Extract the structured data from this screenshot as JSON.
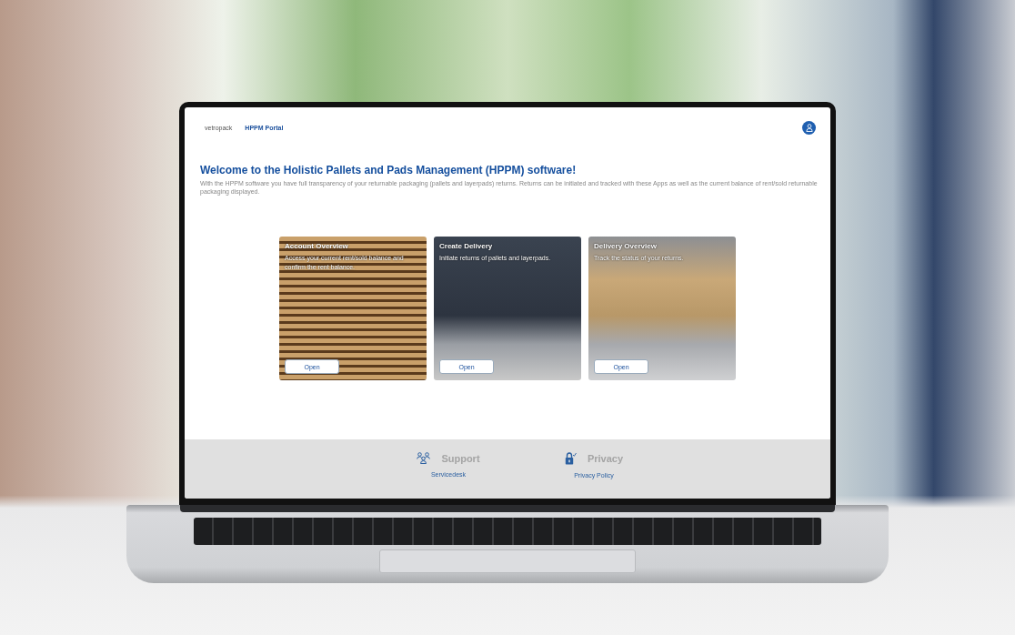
{
  "header": {
    "logo": "vetropack",
    "portal_title": "HPPM Portal"
  },
  "welcome": {
    "title": "Welcome to the Holistic Pallets and Pads Management (HPPM) software!",
    "description": "With the HPPM software you have full transparency of your returnable packaging (pallets and layerpads) returns.  Returns can be initiated and tracked with these Apps as well as the current balance of rent/sold returnable packaging displayed."
  },
  "tiles": [
    {
      "kind": "pallets",
      "title": "Account Overview",
      "description": "Access your current rent/sold balance and confirm the rent balance.",
      "button": "Open"
    },
    {
      "kind": "warehouse",
      "title": "Create Delivery",
      "description": "Initiate returns of pallets and layerpads.",
      "button": "Open"
    },
    {
      "kind": "yard",
      "title": "Delivery Overview",
      "description": "Track the status of your returns.",
      "button": "Open"
    }
  ],
  "footer": [
    {
      "kind": "support",
      "title": "Support",
      "link": "Servicedesk"
    },
    {
      "kind": "privacy",
      "title": "Privacy",
      "link": "Privacy Policy"
    }
  ]
}
